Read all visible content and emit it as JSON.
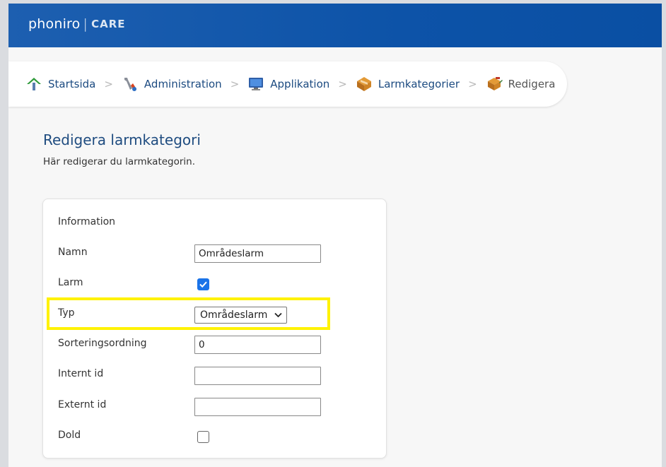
{
  "header": {
    "logo_name": "phoniro",
    "logo_separator": "|",
    "logo_suffix": "CARE",
    "background": "#0d53a8"
  },
  "breadcrumb": {
    "items": [
      {
        "label": "Startsida",
        "icon": "house-icon"
      },
      {
        "label": "Administration",
        "icon": "tools-icon"
      },
      {
        "label": "Applikation",
        "icon": "monitor-icon"
      },
      {
        "label": "Larmkategorier",
        "icon": "category-icon"
      },
      {
        "label": "Redigera",
        "icon": "edit-category-icon"
      }
    ],
    "separator": ">"
  },
  "page": {
    "title": "Redigera larmkategori",
    "subtitle": "Här redigerar du larmkategorin."
  },
  "form": {
    "section_title": "Information",
    "name_label": "Namn",
    "name_value": "Områdeslarm",
    "alarm_label": "Larm",
    "alarm_checked": true,
    "type_label": "Typ",
    "type_value": "Områdeslarm",
    "sort_label": "Sorteringsordning",
    "sort_value": "0",
    "internal_id_label": "Internt id",
    "internal_id_value": "",
    "external_id_label": "Externt id",
    "external_id_value": "",
    "hidden_label": "Dold",
    "hidden_checked": false
  },
  "colors": {
    "accent": "#1a73e8",
    "heading": "#1f4c80",
    "highlight": "#fff200"
  }
}
